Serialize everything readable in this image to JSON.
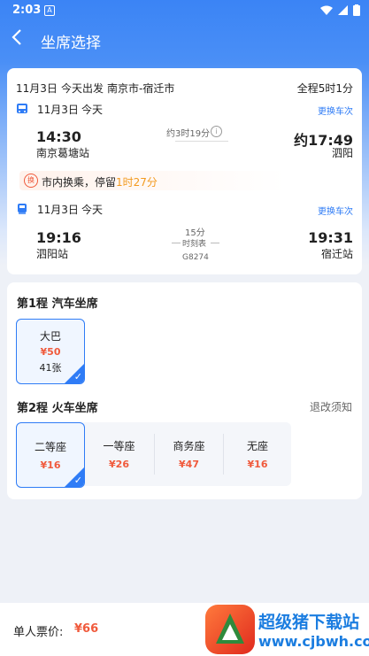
{
  "status_bar": {
    "time": "2:03",
    "notification_icon": "A"
  },
  "nav": {
    "back_icon": "chevron-left",
    "title": "坐席选择"
  },
  "trip": {
    "date": "11月3日",
    "day_label": "今天出发",
    "route": "南京市-宿迁市",
    "total_duration": "全程5时1分",
    "leg1": {
      "date": "11月3日",
      "day": "今天",
      "change_link": "更换车次",
      "depart_time": "14:30",
      "depart_station": "南京葛塘站",
      "duration": "约3时19分",
      "arrive_time": "约17:49",
      "arrive_station": "泗阳"
    },
    "transfer": {
      "text": "市内换乘，停留",
      "wait": "1时27分",
      "icon": "换"
    },
    "leg2": {
      "date": "11月3日",
      "day": "今天",
      "change_link": "更换车次",
      "depart_time": "19:16",
      "depart_station": "泗阳站",
      "duration": "15分",
      "timetable": "时刻表",
      "train_no": "G8274",
      "arrive_time": "19:31",
      "arrive_station": "宿迁站"
    }
  },
  "seats": {
    "leg1_title": "第1程 汽车坐席",
    "bus_seat": {
      "name": "大巴",
      "price": "¥50",
      "count": "41张"
    },
    "leg2_title": "第2程 火车坐席",
    "refund_link": "退改须知",
    "train_seats": [
      {
        "name": "二等座",
        "price": "¥16"
      },
      {
        "name": "一等座",
        "price": "¥26"
      },
      {
        "name": "商务座",
        "price": "¥47"
      },
      {
        "name": "无座",
        "price": "¥16"
      }
    ]
  },
  "bottom": {
    "label": "单人票价:",
    "price": "¥66"
  },
  "watermark": {
    "text": "超级猪下载站",
    "url": "www.cjbwh.com"
  },
  "colors": {
    "primary": "#2f7cf6",
    "price": "#f05a3c",
    "wait": "#f39a1e"
  }
}
